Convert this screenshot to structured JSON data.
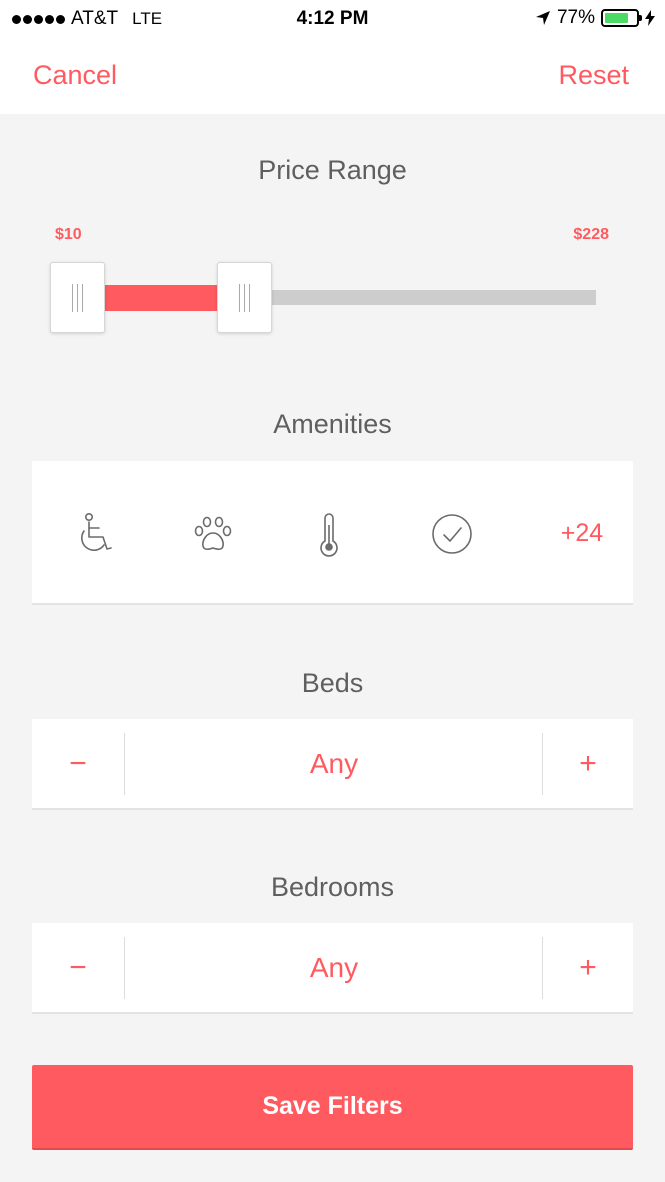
{
  "status_bar": {
    "carrier": "AT&T",
    "network": "LTE",
    "time": "4:12 PM",
    "battery": "77%",
    "battery_level": 0.77
  },
  "nav": {
    "cancel_label": "Cancel",
    "reset_label": "Reset"
  },
  "price_range": {
    "title": "Price Range",
    "min_label": "$10",
    "max_label": "$228"
  },
  "amenities": {
    "title": "Amenities",
    "icons": [
      "wheelchair-icon",
      "paw-icon",
      "thermometer-icon",
      "checkmark-circle-icon"
    ],
    "more_label": "+24"
  },
  "beds": {
    "title": "Beds",
    "minus": "−",
    "value": "Any",
    "plus": "+"
  },
  "bedrooms": {
    "title": "Bedrooms",
    "minus": "−",
    "value": "Any",
    "plus": "+"
  },
  "save_label": "Save Filters",
  "colors": {
    "accent": "#ff5a5f",
    "background": "#f4f4f4",
    "track": "#cdcdcd"
  }
}
